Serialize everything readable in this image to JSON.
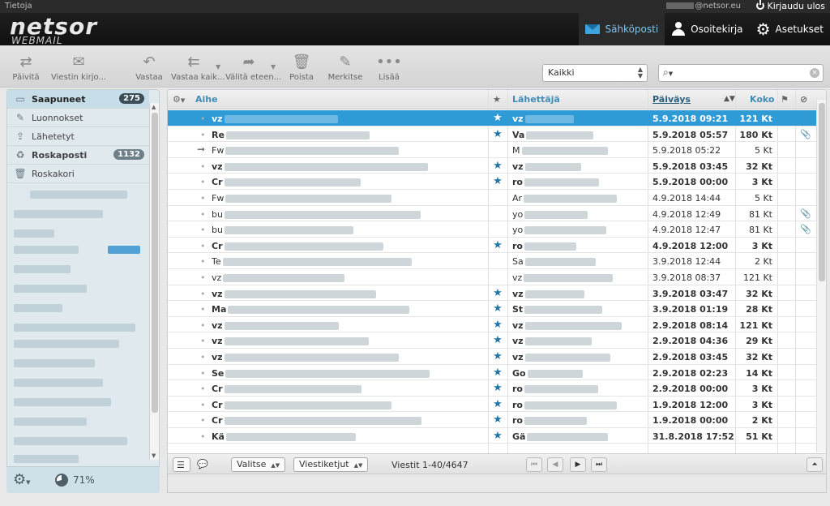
{
  "topbar": {
    "about": "Tietoja",
    "user_domain": "@netsor.eu",
    "logout": "Kirjaudu ulos"
  },
  "header": {
    "logo": "netsor",
    "logo_sub": "WEBMAIL"
  },
  "nav": [
    {
      "label": "Sähköposti",
      "icon": "mail-icon",
      "active": true
    },
    {
      "label": "Osoitekirja",
      "icon": "person-icon",
      "active": false
    },
    {
      "label": "Asetukset",
      "icon": "gear-icon",
      "active": false
    }
  ],
  "toolbar": {
    "refresh": "Päivitä",
    "compose": "Viestin kirjo...",
    "reply": "Vastaa",
    "reply_all": "Vastaa kaik...",
    "forward": "Välitä eteen...",
    "delete": "Poista",
    "mark": "Merkitse",
    "more": "Lisää"
  },
  "filter": {
    "selected": "Kaikki"
  },
  "search": {
    "placeholder": ""
  },
  "folders": [
    {
      "label": "Saapuneet",
      "count": "275",
      "icon": "inbox-icon",
      "selected": true,
      "bold": true
    },
    {
      "label": "Luonnokset",
      "count": "",
      "icon": "pencil-icon"
    },
    {
      "label": "Lähetetyt",
      "count": "",
      "icon": "sent-icon"
    },
    {
      "label": "Roskaposti",
      "count": "1132",
      "icon": "spam-icon",
      "bold": true
    },
    {
      "label": "Roskakori",
      "count": "",
      "icon": "trash-icon"
    }
  ],
  "quota": "71%",
  "list_header": {
    "subject": "Aihe",
    "from": "Lähettäjä",
    "date": "Päiväys",
    "size": "Koko"
  },
  "messages": [
    {
      "subject": "vz",
      "from": "vz",
      "date": "5.9.2018 09:21",
      "size": "121 Kt",
      "flagged": true,
      "unread": true,
      "selected": true,
      "attach": false
    },
    {
      "subject": "Re",
      "from": "Va",
      "date": "5.9.2018 05:57",
      "size": "180 Kt",
      "flagged": true,
      "unread": true,
      "attach": true
    },
    {
      "subject": "Fw",
      "from": "M",
      "date": "5.9.2018 05:22",
      "size": "5 Kt",
      "flagged": false,
      "unread": false,
      "forwarded": true
    },
    {
      "subject": "vz",
      "from": "vz",
      "date": "5.9.2018 03:45",
      "size": "32 Kt",
      "flagged": true,
      "unread": true
    },
    {
      "subject": "Cr",
      "from": "ro",
      "date": "5.9.2018 00:00",
      "size": "3 Kt",
      "flagged": true,
      "unread": true
    },
    {
      "subject": "Fw",
      "from": "Ar",
      "date": "4.9.2018 14:44",
      "size": "5 Kt",
      "flagged": false,
      "unread": false
    },
    {
      "subject": "bu",
      "from": "yo",
      "date": "4.9.2018 12:49",
      "size": "81 Kt",
      "flagged": false,
      "unread": false,
      "attach": true
    },
    {
      "subject": "bu",
      "from": "yo",
      "date": "4.9.2018 12:47",
      "size": "81 Kt",
      "flagged": false,
      "unread": false,
      "attach": true
    },
    {
      "subject": "Cr",
      "from": "ro",
      "date": "4.9.2018 12:00",
      "size": "3 Kt",
      "flagged": true,
      "unread": true
    },
    {
      "subject": "Te",
      "from": "Sa",
      "date": "3.9.2018 12:44",
      "size": "2 Kt",
      "flagged": false,
      "unread": false
    },
    {
      "subject": "vz",
      "from": "vz",
      "date": "3.9.2018 08:37",
      "size": "121 Kt",
      "flagged": false,
      "unread": false
    },
    {
      "subject": "vz",
      "from": "vz",
      "date": "3.9.2018 03:47",
      "size": "32 Kt",
      "flagged": true,
      "unread": true
    },
    {
      "subject": "Ma",
      "from": "St",
      "date": "3.9.2018 01:19",
      "size": "28 Kt",
      "flagged": true,
      "unread": true
    },
    {
      "subject": "vz",
      "from": "vz",
      "date": "2.9.2018 08:14",
      "size": "121 Kt",
      "flagged": true,
      "unread": true
    },
    {
      "subject": "vz",
      "from": "vz",
      "date": "2.9.2018 04:36",
      "size": "29 Kt",
      "flagged": true,
      "unread": true
    },
    {
      "subject": "vz",
      "from": "vz",
      "date": "2.9.2018 03:45",
      "size": "32 Kt",
      "flagged": true,
      "unread": true
    },
    {
      "subject": "Se",
      "from": "Go",
      "date": "2.9.2018 02:23",
      "size": "14 Kt",
      "flagged": true,
      "unread": true
    },
    {
      "subject": "Cr",
      "from": "ro",
      "date": "2.9.2018 00:00",
      "size": "3 Kt",
      "flagged": true,
      "unread": true
    },
    {
      "subject": "Cr",
      "from": "ro",
      "date": "1.9.2018 12:00",
      "size": "3 Kt",
      "flagged": true,
      "unread": true
    },
    {
      "subject": "Cr",
      "from": "ro",
      "date": "1.9.2018 00:00",
      "size": "2 Kt",
      "flagged": true,
      "unread": true
    },
    {
      "subject": "Kä",
      "from": "Gä",
      "date": "31.8.2018 17:52",
      "size": "51 Kt",
      "flagged": true,
      "unread": true
    }
  ],
  "list_footer": {
    "select": "Valitse",
    "threads": "Viestiketjut",
    "count": "Viestit 1-40/4647"
  },
  "colors": {
    "accent": "#2e9ad6",
    "header_bg": "#111111",
    "sidebar_bg": "#dfe9ee",
    "star": "#2075a8"
  }
}
